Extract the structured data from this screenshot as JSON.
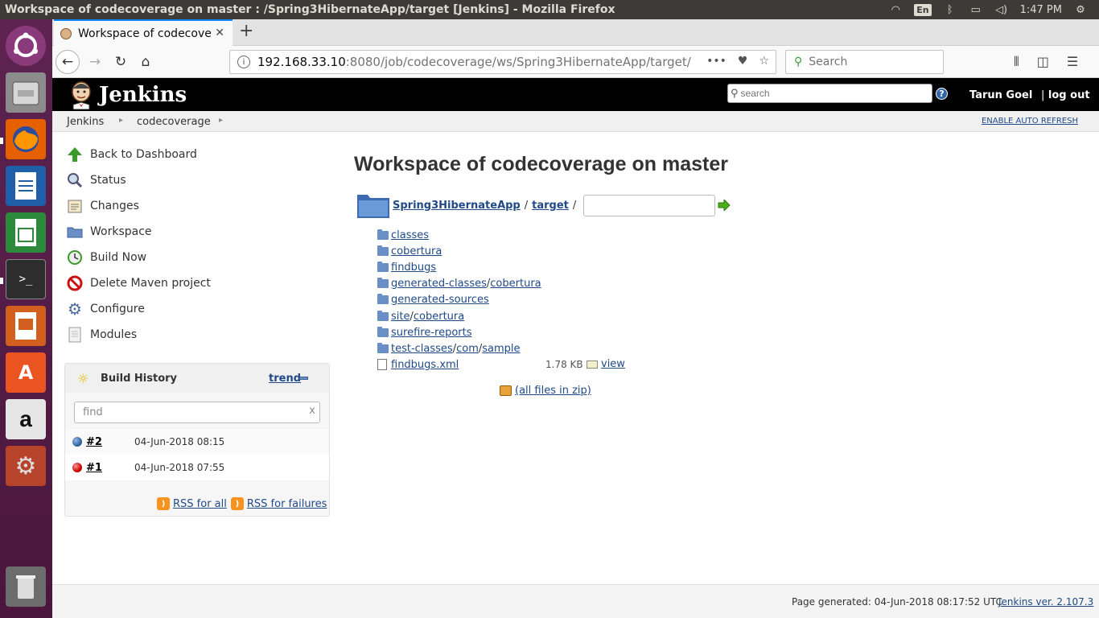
{
  "os": {
    "window_title": "Workspace of codecoverage on master : /Spring3HibernateApp/target [Jenkins] - Mozilla Firefox",
    "keyboard_lang": "En",
    "clock": "1:47 PM"
  },
  "browser": {
    "tab_title": "Workspace of codecoverage",
    "url_host": "192.168.33.10",
    "url_rest": ":8080/job/codecoverage/ws/Spring3HibernateApp/target/",
    "search_placeholder": "Search"
  },
  "header": {
    "logo_text": "Jenkins",
    "search_placeholder": "search",
    "help": "?",
    "user": "Tarun Goel",
    "logout": "log out",
    "logout_sep": "|"
  },
  "breadcrumb": {
    "items": [
      "Jenkins",
      "codecoverage"
    ],
    "auto_refresh": "ENABLE AUTO REFRESH"
  },
  "sidepanel": {
    "tasks": [
      {
        "label": "Back to Dashboard",
        "icon": "up-arrow-icon"
      },
      {
        "label": "Status",
        "icon": "magnifier-icon"
      },
      {
        "label": "Changes",
        "icon": "notepad-icon"
      },
      {
        "label": "Workspace",
        "icon": "folder-icon"
      },
      {
        "label": "Build Now",
        "icon": "clock-icon"
      },
      {
        "label": "Delete Maven project",
        "icon": "no-entry-icon"
      },
      {
        "label": "Configure",
        "icon": "gear-icon"
      },
      {
        "label": "Modules",
        "icon": "document-icon"
      }
    ]
  },
  "build_history": {
    "title": "Build History",
    "trend": "trend",
    "find_placeholder": "find",
    "clear": "x",
    "builds": [
      {
        "number": "#2",
        "date": "04-Jun-2018 08:15",
        "status_color": "#3465a4"
      },
      {
        "number": "#1",
        "date": "04-Jun-2018 07:55",
        "status_color": "#cc0000"
      }
    ],
    "rss_all": "RSS for all",
    "rss_failures": "RSS for failures"
  },
  "main": {
    "title": "Workspace of codecoverage on master",
    "path": [
      "Spring3HibernateApp",
      "target"
    ],
    "path_sep": "/",
    "entries": [
      {
        "type": "dir",
        "parts": [
          "classes"
        ]
      },
      {
        "type": "dir",
        "parts": [
          "cobertura"
        ]
      },
      {
        "type": "dir",
        "parts": [
          "findbugs"
        ]
      },
      {
        "type": "dir",
        "parts": [
          "generated-classes",
          "cobertura"
        ]
      },
      {
        "type": "dir",
        "parts": [
          "generated-sources"
        ]
      },
      {
        "type": "dir",
        "parts": [
          "site",
          "cobertura"
        ]
      },
      {
        "type": "dir",
        "parts": [
          "surefire-reports"
        ]
      },
      {
        "type": "dir",
        "parts": [
          "test-classes",
          "com",
          "sample"
        ]
      },
      {
        "type": "file",
        "parts": [
          "findbugs.xml"
        ]
      }
    ],
    "file_size": "1.78 KB",
    "file_view": "view",
    "zip_link": "(all files in zip)"
  },
  "footer": {
    "generated": "Page generated: 04-Jun-2018 08:17:52 UTC",
    "version": "Jenkins ver. 2.107.3"
  }
}
